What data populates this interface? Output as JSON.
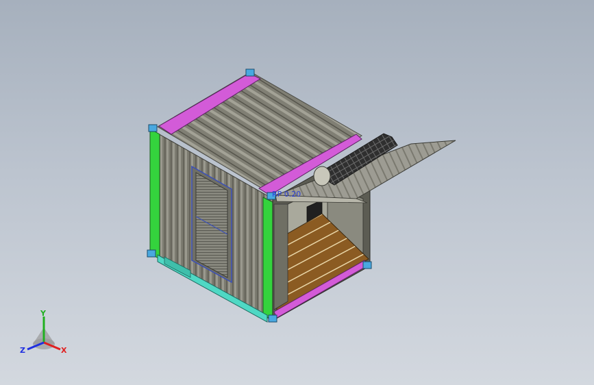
{
  "viewport": {
    "model_name": "container-model",
    "dimension_label": "RP 0.20",
    "colors": {
      "background_top": "#a6b0bd",
      "background_bottom": "#d3d8df",
      "corrugated_metal": "#7d7d72",
      "top_rail": "#d056d6",
      "corner_post": "#2fd13a",
      "bottom_rail": "#4fd6c2",
      "corner_casting": "#3f9fd8",
      "floor_wood": "#8a5a22",
      "solar_panel": "#3a3a3a"
    }
  },
  "triad": {
    "x_label": "X",
    "y_label": "Y",
    "z_label": "Z",
    "x_color": "#e02020",
    "y_color": "#20b020",
    "z_color": "#2030e0"
  }
}
